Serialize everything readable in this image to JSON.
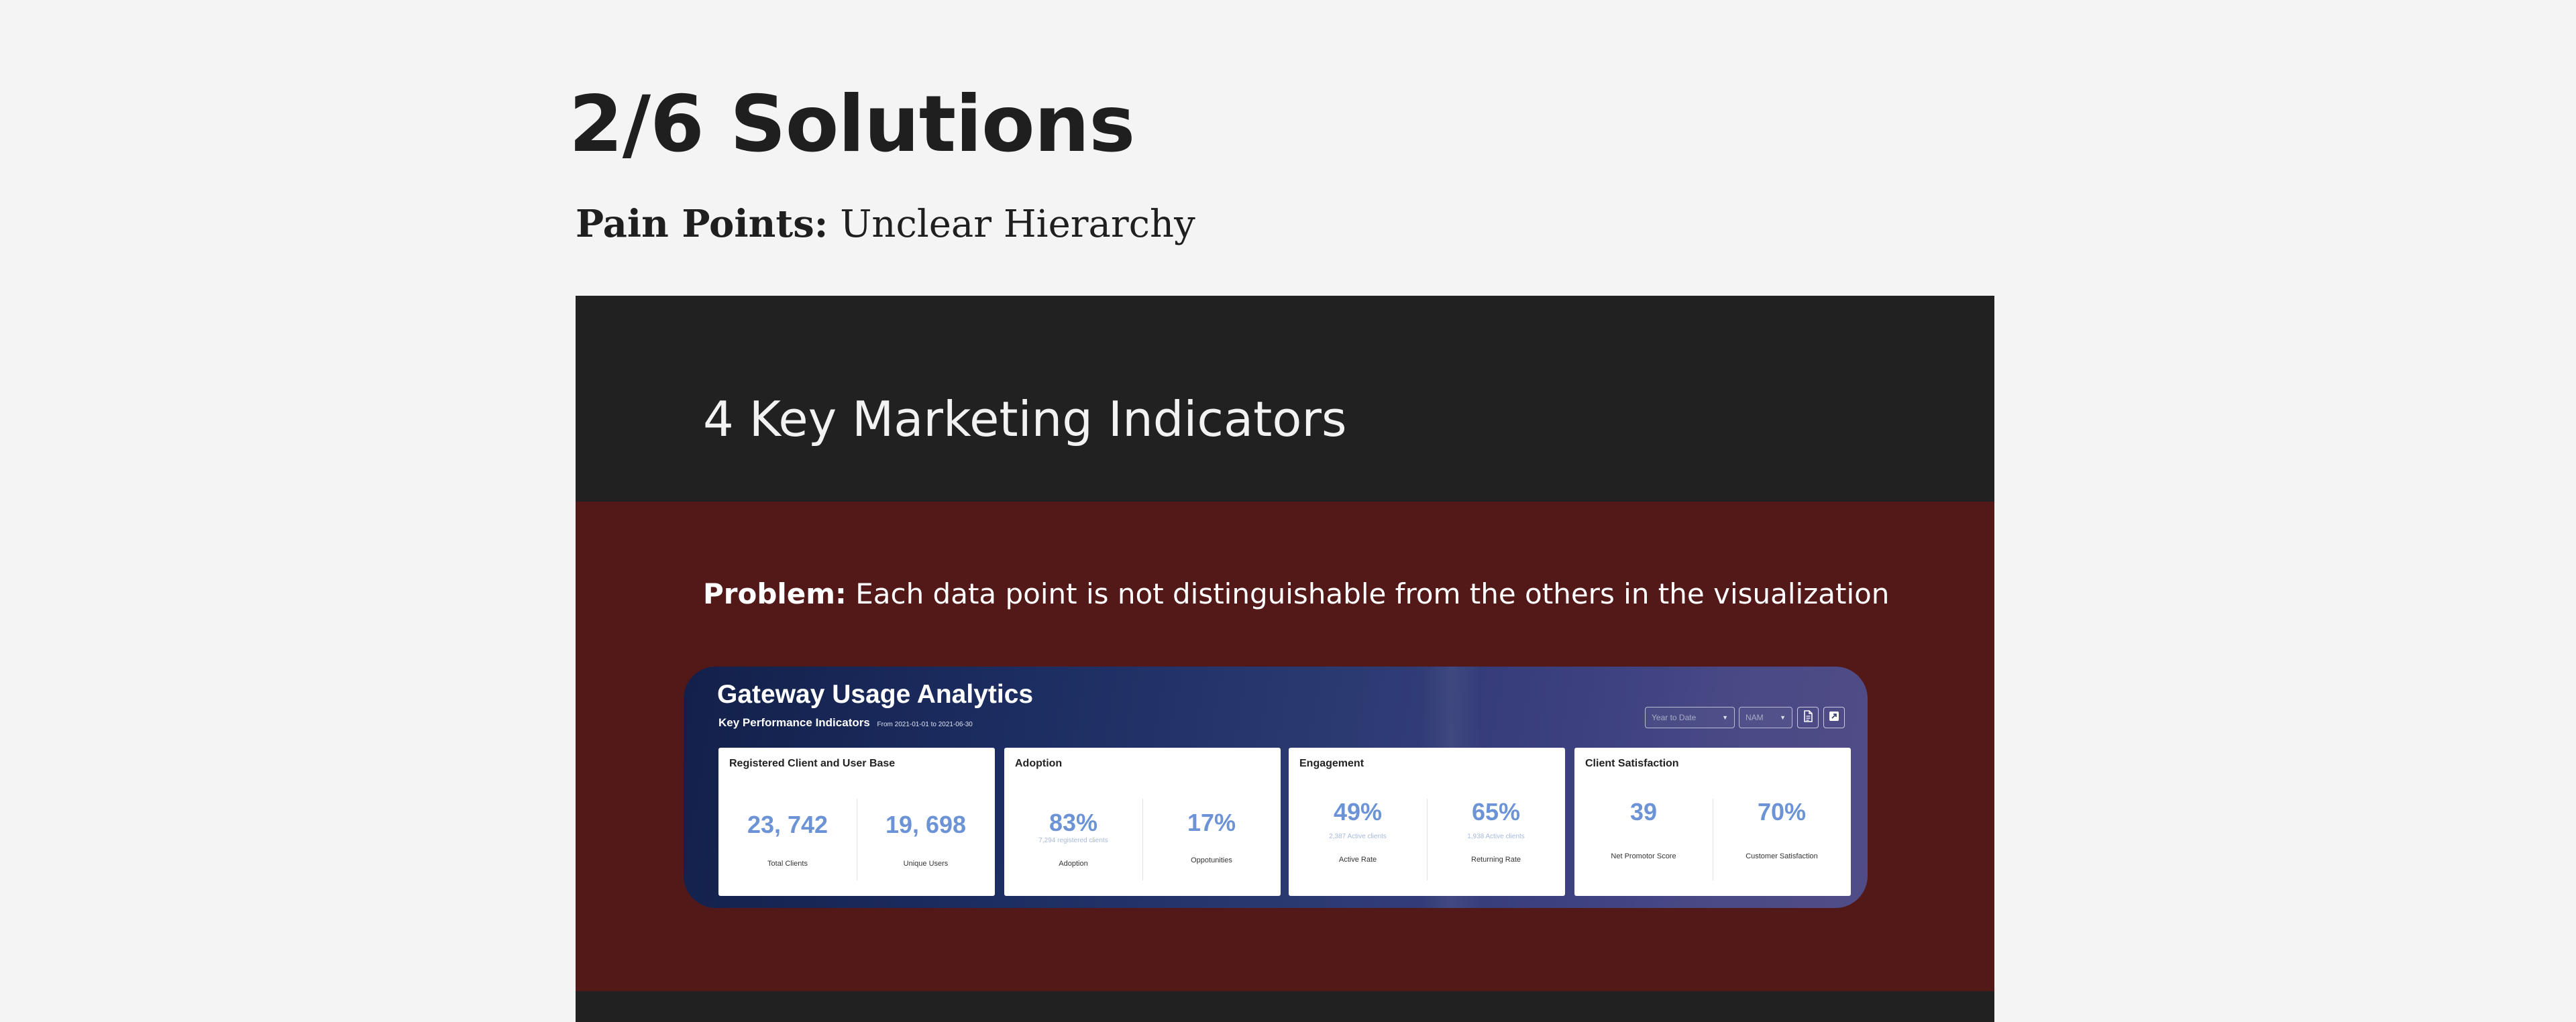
{
  "page": {
    "title": "2/6 Solutions",
    "pain_label": "Pain Points:",
    "pain_text": "Unclear Hierarchy"
  },
  "section": {
    "heading": "4 Key Marketing Indicators",
    "problem_label": "Problem:",
    "problem_text": "Each data point is not distinguishable from the others in the visualization"
  },
  "dashboard": {
    "title": "Gateway Usage Analytics",
    "subtitle": "Key Performance Indicators",
    "date_range": "From 2021-01-01 to 2021-06-30",
    "filters": {
      "period": "Year to Date",
      "region": "NAM"
    },
    "icons": {
      "document": "document-icon",
      "export": "export-icon"
    },
    "cards": [
      {
        "title": "Registered Client and User Base",
        "metrics": [
          {
            "value": "23, 742",
            "sub": "",
            "label": "Total Clients"
          },
          {
            "value": "19, 698",
            "sub": "",
            "label": "Unique Users"
          }
        ]
      },
      {
        "title": "Adoption",
        "metrics": [
          {
            "value": "83%",
            "sub": "7,294 registered clients",
            "label": "Adoption"
          },
          {
            "value": "17%",
            "sub": "",
            "label": "Oppotunities"
          }
        ]
      },
      {
        "title": "Engagement",
        "metrics": [
          {
            "value": "49%",
            "sub": "2,387 Active clients",
            "label": "Active Rate"
          },
          {
            "value": "65%",
            "sub": "1,938 Active clients",
            "label": "Returning Rate"
          }
        ]
      },
      {
        "title": "Client Satisfaction",
        "metrics": [
          {
            "value": "39",
            "sub": "",
            "label": "Net Promotor Score"
          },
          {
            "value": "70%",
            "sub": "",
            "label": "Customer Satisfaction"
          }
        ]
      }
    ]
  },
  "colors": {
    "page_bg": "#f4f4f4",
    "dark_section": "#212121",
    "problem_section": "#531919",
    "dashboard_gradient_start": "#13204a",
    "dashboard_gradient_end": "#514c87",
    "metric_value": "#6b93d6"
  }
}
